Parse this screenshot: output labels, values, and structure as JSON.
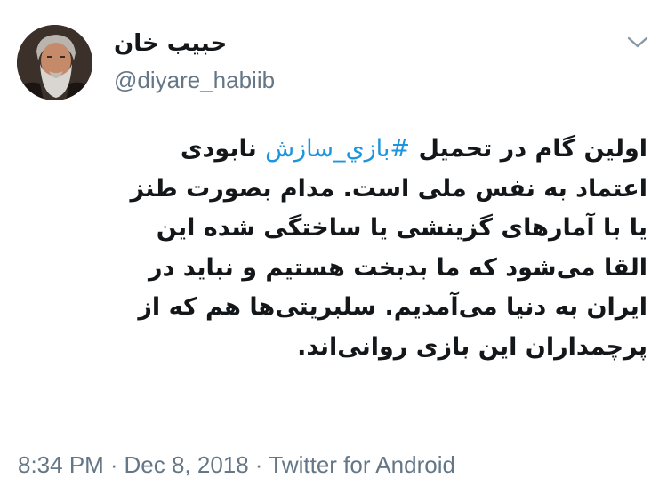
{
  "tweet": {
    "author": {
      "display_name": "حبیب خان",
      "handle": "@diyare_habiib",
      "avatar_icon": "bearded-man-avatar"
    },
    "menu_icon": "chevron-down-icon",
    "text_lines": [
      {
        "before": "اولین گام در تحمیل ",
        "hashtag": "#بازي_سازش",
        "after": " نابودی"
      },
      {
        "before": "اعتماد به نفس ملی است. مدام بصورت طنز",
        "hashtag": "",
        "after": ""
      },
      {
        "before": "یا با آمارهای گزینشی یا ساختگی شده این",
        "hashtag": "",
        "after": ""
      },
      {
        "before": "القا می‌شود که ما بدبخت هستیم و نباید در",
        "hashtag": "",
        "after": ""
      },
      {
        "before": "ایران به دنیا می‌آمدیم. سلبریتی‌ها هم که از",
        "hashtag": "",
        "after": ""
      },
      {
        "before": "پرچمداران این بازی روانی‌اند.",
        "hashtag": "",
        "after": ""
      }
    ],
    "time": "8:34 PM",
    "separator": "·",
    "date": "Dec 8, 2018",
    "source": "Twitter for Android",
    "colors": {
      "text": "#14171a",
      "secondary": "#657786",
      "link": "#1b95e0"
    }
  }
}
